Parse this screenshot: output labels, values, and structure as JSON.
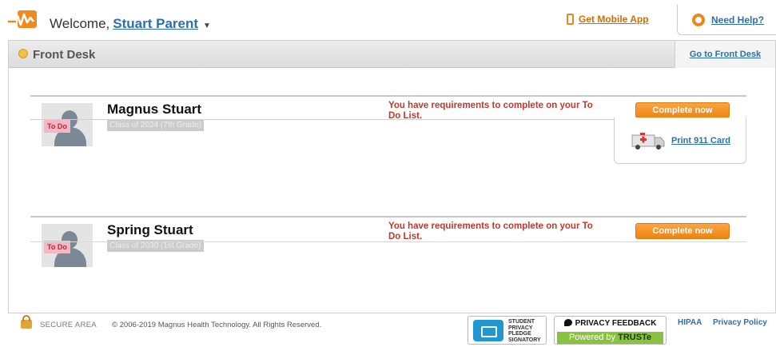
{
  "header": {
    "welcome_text": "Welcome,",
    "user_name": "Stuart Parent",
    "mobile_app": "Get Mobile App",
    "need_help": "Need Help?"
  },
  "front_desk": {
    "title": "Front Desk",
    "goto_link": "Go to Front Desk"
  },
  "students": [
    {
      "name": "Magnus Stuart",
      "class": "Class of 2024 (7th Grade)",
      "badge": "To Do",
      "requirements_msg": "You have requirements to complete on your To Do List.",
      "action": "Complete now"
    },
    {
      "name": "Spring Stuart",
      "class": "Class of 2030 (1st Grade)",
      "badge": "To Do",
      "requirements_msg": "You have requirements to complete on your To Do List.",
      "action": "Complete now"
    }
  ],
  "card911": {
    "label": "Print 911 Card"
  },
  "footer": {
    "secure": "SECURE AREA",
    "copyright": "© 2006-2019 Magnus Health Technology. All Rights Reserved.",
    "pledge_lines": [
      "STUDENT",
      "PRIVACY",
      "PLEDGE",
      "SIGNATORY"
    ],
    "privacy_feedback": "PRIVACY FEEDBACK",
    "powered_by": "Powered by",
    "truste": "TRUSTe",
    "hipaa": "HIPAA",
    "privacy_policy": "Privacy Policy"
  },
  "colors": {
    "accent_orange": "#ee8412",
    "link_blue": "#2a6fb0",
    "alert_red": "#c0392b"
  }
}
